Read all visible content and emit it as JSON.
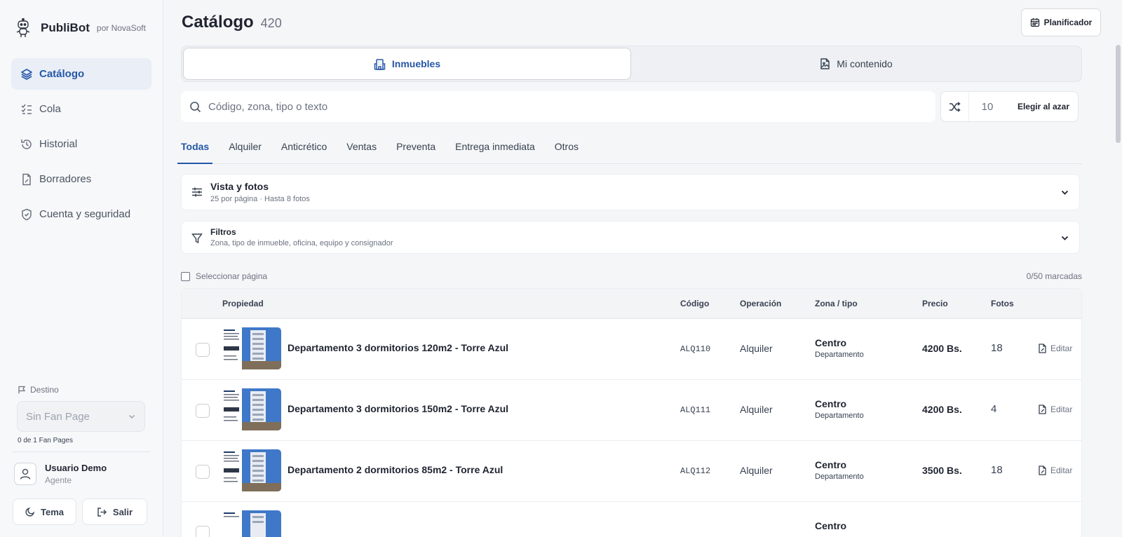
{
  "brand": {
    "name": "PubliBot",
    "sub": "por NovaSoft"
  },
  "sidebar": {
    "items": [
      {
        "label": "Catálogo",
        "icon": "layers-icon",
        "active": true
      },
      {
        "label": "Cola",
        "icon": "checklist-icon",
        "active": false
      },
      {
        "label": "Historial",
        "icon": "history-icon",
        "active": false
      },
      {
        "label": "Borradores",
        "icon": "draft-icon",
        "active": false
      },
      {
        "label": "Cuenta y seguridad",
        "icon": "shield-icon",
        "active": false
      }
    ],
    "destination_label": "Destino",
    "destination_value": "Sin Fan Page",
    "fanpage_count": "0 de 1 Fan Pages",
    "user": {
      "name": "Usuario Demo",
      "role": "Agente"
    },
    "theme_label": "Tema",
    "logout_label": "Salir"
  },
  "header": {
    "title": "Catálogo",
    "count": "420",
    "planner_label": "Planificador"
  },
  "toggle": {
    "active": "Inmuebles",
    "inactive": "Mi contenido"
  },
  "search": {
    "placeholder": "Código, zona, tipo o texto",
    "random_count": "10",
    "random_label": "Elegir al azar"
  },
  "tabs": [
    "Todas",
    "Alquiler",
    "Anticrético",
    "Ventas",
    "Preventa",
    "Entrega inmediata",
    "Otros"
  ],
  "panels": {
    "view": {
      "title": "Vista y fotos",
      "subtitle": "25 por página · Hasta 8 fotos"
    },
    "filters": {
      "title": "Filtros",
      "subtitle": "Zona, tipo de inmueble, oficina, equipo y consignador"
    }
  },
  "selection": {
    "label": "Seleccionar página",
    "marked": "0/50 marcadas"
  },
  "table": {
    "headers": {
      "property": "Propiedad",
      "code": "Código",
      "operation": "Operación",
      "zone": "Zona / tipo",
      "price": "Precio",
      "photos": "Fotos"
    },
    "edit_label": "Editar",
    "rows": [
      {
        "title": "Departamento 3 dormitorios 120m2 - Torre Azul",
        "code": "ALQ110",
        "operation": "Alquiler",
        "zone": "Centro",
        "type": "Departamento",
        "price": "4200 Bs.",
        "photos": "18"
      },
      {
        "title": "Departamento 3 dormitorios 150m2 - Torre Azul",
        "code": "ALQ111",
        "operation": "Alquiler",
        "zone": "Centro",
        "type": "Departamento",
        "price": "4200 Bs.",
        "photos": "4"
      },
      {
        "title": "Departamento 2 dormitorios 85m2 - Torre Azul",
        "code": "ALQ112",
        "operation": "Alquiler",
        "zone": "Centro",
        "type": "Departamento",
        "price": "3500 Bs.",
        "photos": "18"
      },
      {
        "title": "",
        "code": "",
        "operation": "",
        "zone": "Centro",
        "type": "",
        "price": "",
        "photos": ""
      }
    ]
  },
  "colors": {
    "accent": "#2557a7",
    "sidebar_bg": "#f7f8fa",
    "page_bg": "#f5f6f8"
  }
}
